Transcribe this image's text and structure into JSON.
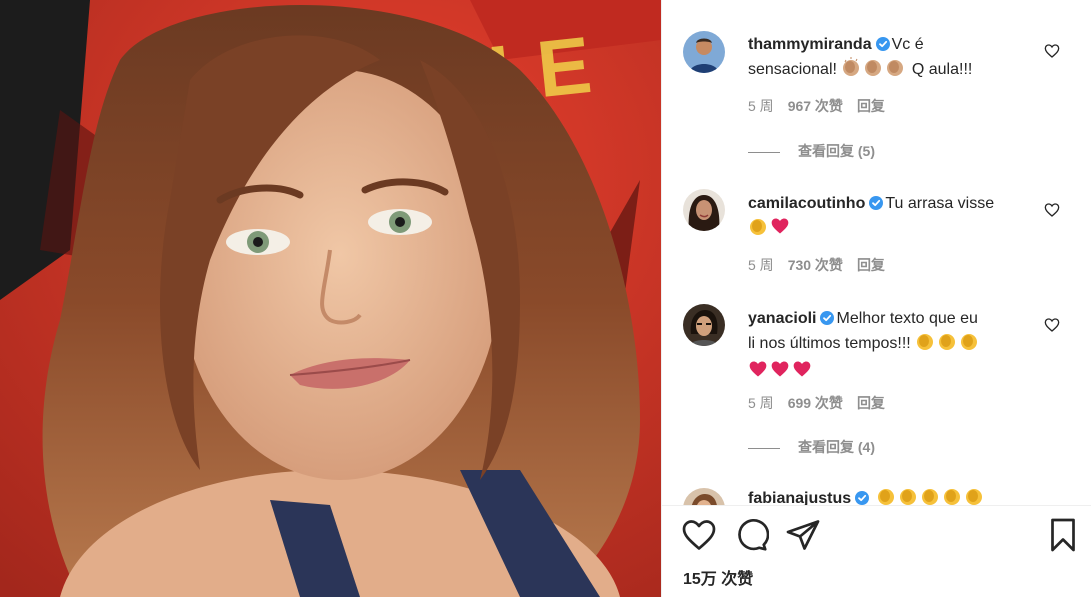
{
  "comments": [
    {
      "username": "thammymiranda",
      "text_line1": "Vc é",
      "text_line2_a": "sensacional!",
      "text_line2_b": "Q aula!!!",
      "time": "5 周",
      "likes": "967 次赞",
      "reply": "回复",
      "view_replies": "查看回复 (5)",
      "emoji_line2": [
        "clap-medium",
        "clap-medium",
        "clap-medium"
      ]
    },
    {
      "username": "camilacoutinho",
      "text_line1": "Tu arrasa visse",
      "time": "5 周",
      "likes": "730 次赞",
      "reply": "回复",
      "emoji_line2": [
        "clap-yellow",
        "red-heart"
      ]
    },
    {
      "username": "yanacioli",
      "text_line1": "Melhor texto que eu",
      "text_line2_a": "li nos últimos tempos!!!",
      "time": "5 周",
      "likes": "699 次赞",
      "reply": "回复",
      "view_replies": "查看回复 (4)",
      "emoji_line2": [
        "clap-yellow",
        "clap-yellow",
        "clap-yellow"
      ],
      "emoji_line3": [
        "red-heart",
        "red-heart",
        "red-heart"
      ]
    },
    {
      "username": "fabianajustus",
      "emoji_line1": [
        "clap-yellow",
        "clap-yellow",
        "clap-yellow",
        "clap-yellow",
        "clap-yellow"
      ]
    }
  ],
  "actions": {
    "like_icon": "heart-outline-icon",
    "comment_icon": "comment-bubble-icon",
    "share_icon": "paper-plane-icon",
    "save_icon": "bookmark-icon"
  },
  "likes_total": "15万 次赞",
  "colors": {
    "verified": "#3897f0",
    "muted_text": "#8e8e8e",
    "heart_red": "#e0245e"
  }
}
